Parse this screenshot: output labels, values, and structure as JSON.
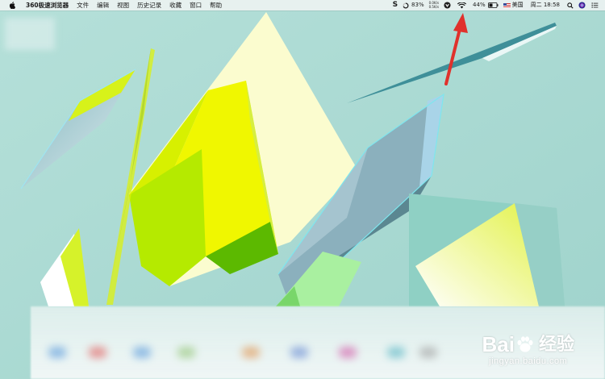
{
  "menubar": {
    "app_name": "360极速浏览器",
    "menus": [
      "文件",
      "编辑",
      "视图",
      "历史记录",
      "收藏",
      "窗口",
      "帮助"
    ],
    "status": {
      "sync_icon_label": "S",
      "cpu_percent": "83%",
      "net_up": "0.0K/s",
      "net_down": "0.5K/s",
      "battery_percent": "44%",
      "input_source": "美国",
      "clock": "周二 18:58"
    }
  },
  "watermark": {
    "logo_text": "Bai",
    "logo_suffix": "经验",
    "url": "jingyan.baidu.com"
  },
  "annotation": {
    "arrow_color": "#e0312c"
  },
  "colors": {
    "background": "#a8d8d0",
    "yellow": "#e8f510",
    "cream": "#fdfdd2",
    "teal": "#4f9aa0"
  }
}
